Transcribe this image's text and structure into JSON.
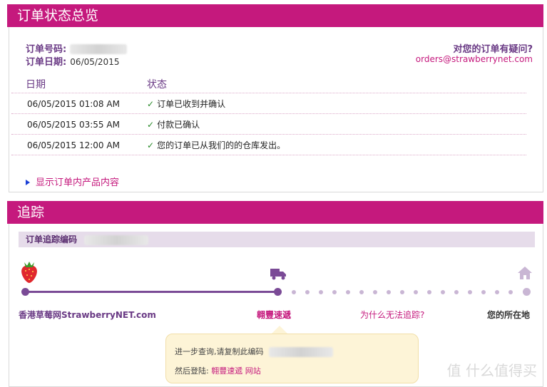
{
  "order_section": {
    "title": "订单状态总览",
    "order_no_label": "订单号码:",
    "order_date_label": "订单日期:",
    "order_date_value": "06/05/2015",
    "question_title": "对您的订单有疑问?",
    "question_email": "orders@strawberrynet.com",
    "columns": [
      "日期",
      "状态"
    ],
    "rows": [
      {
        "date": "06/05/2015 01:08 AM",
        "status": "订单已收到并确认"
      },
      {
        "date": "06/05/2015 03:55 AM",
        "status": "付款已确认"
      },
      {
        "date": "06/05/2015 12:00 AM",
        "status": "您的订单已从我们的的仓库发出。"
      }
    ],
    "show_products_link": "显示订单内产品内容"
  },
  "tracking_section": {
    "title": "追踪",
    "tracking_no_label": "订单追踪编码",
    "stages": {
      "origin": "香港草莓网StrawberryNET.com",
      "carrier": "翱豐速遞",
      "why_no_track": "为什么无法追踪?",
      "destination": "您的所在地"
    },
    "tooltip": {
      "line1": "进一步查询,请复制此编码",
      "line2_prefix": "然后登陆:",
      "line2_link": "翱豐速遞 网站"
    }
  },
  "watermark": "值 什么值得买",
  "colors": {
    "header_bg": "#c5197d",
    "accent_purple": "#6a3a85",
    "link_pink": "#c5197d"
  },
  "icons": [
    "strawberry-icon",
    "truck-icon",
    "home-icon",
    "checkmark-icon",
    "triangle-right-icon"
  ]
}
